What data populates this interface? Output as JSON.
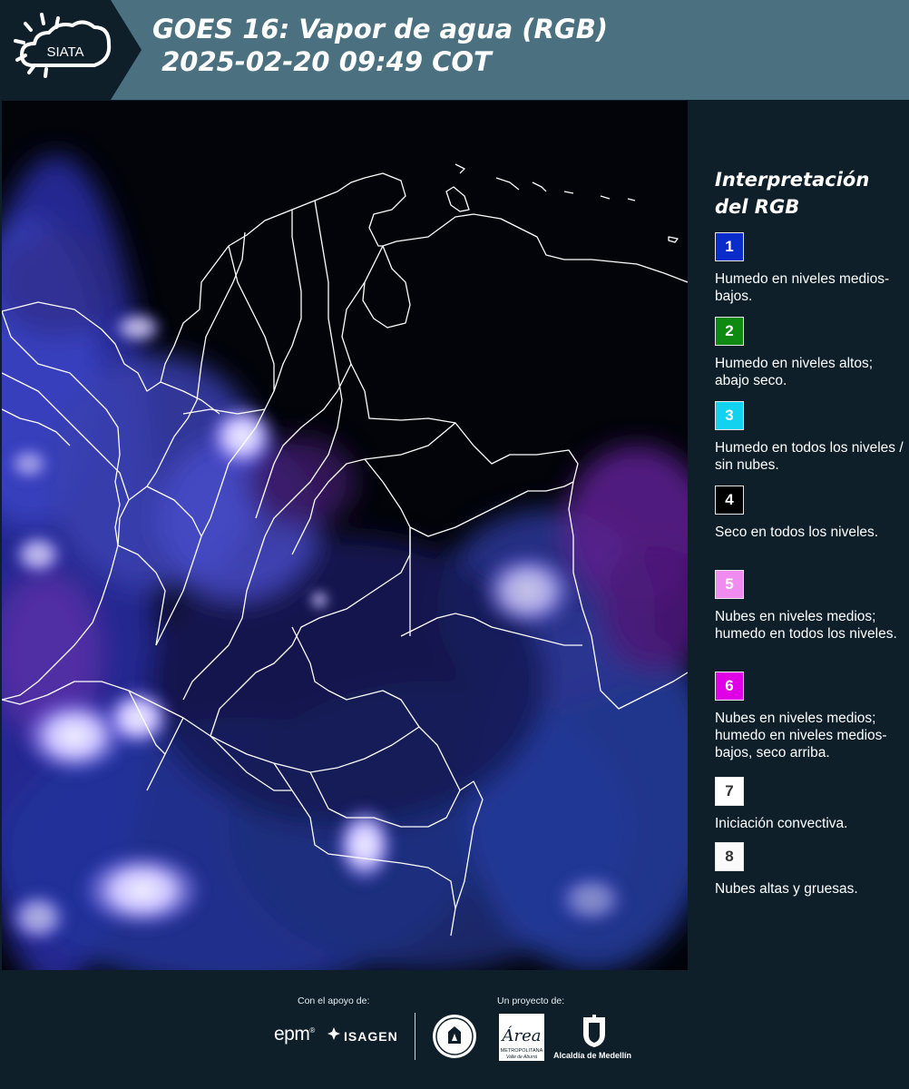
{
  "header": {
    "brand": "SIATA",
    "title_line1": "GOES 16: Vapor de agua (RGB)",
    "title_line2": " 2025-02-20 09:49 COT"
  },
  "map": {
    "background_color": "#02040a",
    "border_color": "#ffffff"
  },
  "legend": {
    "title": "Interpretación del RGB",
    "items": [
      {
        "number": "1",
        "color": "#0a2cc8",
        "text_color": "#ffffff",
        "label": "Humedo en niveles medios-bajos."
      },
      {
        "number": "2",
        "color": "#0e8a12",
        "text_color": "#ffffff",
        "label": "Humedo en niveles altos; abajo seco."
      },
      {
        "number": "3",
        "color": "#12d2f0",
        "text_color": "#ffffff",
        "label": "Humedo en todos los niveles / sin nubes."
      },
      {
        "number": "4",
        "color": "#000000",
        "text_color": "#ffffff",
        "label": "Seco en todos los niveles."
      },
      {
        "number": "5",
        "color": "#f08cf0",
        "text_color": "#ffffff",
        "label": "Nubes en niveles medios; humedo en todos los niveles."
      },
      {
        "number": "6",
        "color": "#e000e6",
        "text_color": "#ffffff",
        "label": "Nubes en niveles medios; humedo en niveles medios-bajos, seco arriba."
      },
      {
        "number": "7",
        "color": "#ffffff",
        "text_color": "#333333",
        "label": "Iniciación convectiva."
      },
      {
        "number": "8",
        "color": "#fafafa",
        "text_color": "#333333",
        "label": "Nubes altas y gruesas."
      }
    ]
  },
  "footer": {
    "support_label": "Con el apoyo de:",
    "project_label": "Un proyecto de:",
    "sponsors": [
      "epm",
      "ISAGEN"
    ],
    "partners": [
      "METROPOLITANA",
      "Valle de Aburrá",
      "Alcaldía de Medellín"
    ],
    "area_script": "Área"
  }
}
